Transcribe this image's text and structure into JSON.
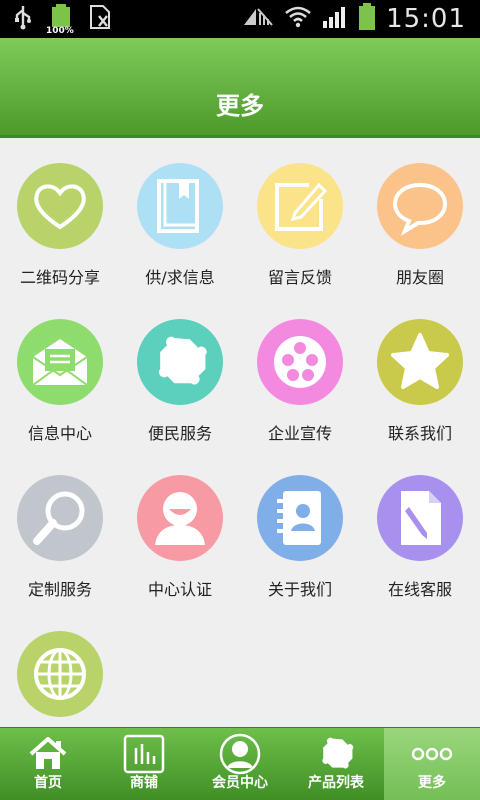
{
  "status_bar": {
    "battery_label": "100%",
    "time": "15:01"
  },
  "header": {
    "title": "更多"
  },
  "grid": {
    "items": [
      {
        "label": "二维码分享",
        "icon": "heart-icon",
        "color": "#b7d36a"
      },
      {
        "label": "供/求信息",
        "icon": "book-icon",
        "color": "#aee0f5"
      },
      {
        "label": "留言反馈",
        "icon": "edit-icon",
        "color": "#fbe38a"
      },
      {
        "label": "朋友圈",
        "icon": "chat-bubble-icon",
        "color": "#fbc28a"
      },
      {
        "label": "信息中心",
        "icon": "mail-icon",
        "color": "#8fdc6e"
      },
      {
        "label": "便民服务",
        "icon": "puzzle-icon",
        "color": "#5ccfbd"
      },
      {
        "label": "企业宣传",
        "icon": "film-reel-icon",
        "color": "#f48ae0"
      },
      {
        "label": "联系我们",
        "icon": "star-icon",
        "color": "#c9c94c"
      },
      {
        "label": "定制服务",
        "icon": "magnifier-icon",
        "color": "#c0c6cc"
      },
      {
        "label": "中心认证",
        "icon": "user-icon",
        "color": "#f79aa3"
      },
      {
        "label": "关于我们",
        "icon": "contacts-icon",
        "color": "#7faee8"
      },
      {
        "label": "在线客服",
        "icon": "document-edit-icon",
        "color": "#a891ee"
      },
      {
        "label": "",
        "icon": "globe-icon",
        "color": "#b7d36a"
      }
    ]
  },
  "tabbar": {
    "tabs": [
      {
        "label": "首页",
        "icon": "home-icon"
      },
      {
        "label": "商铺",
        "icon": "chart-icon"
      },
      {
        "label": "会员中心",
        "icon": "member-icon"
      },
      {
        "label": "产品列表",
        "icon": "puzzle-icon"
      },
      {
        "label": "更多",
        "icon": "more-icon",
        "active": true
      }
    ]
  }
}
